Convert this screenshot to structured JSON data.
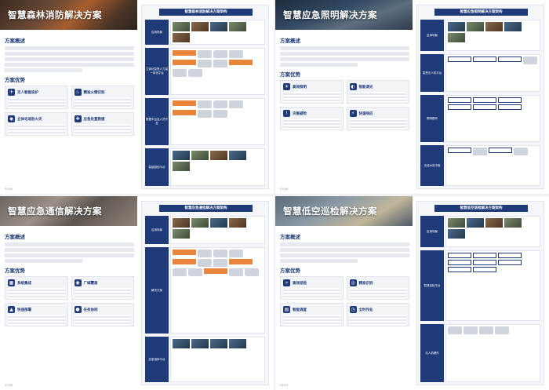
{
  "pages": [
    {
      "title": "智慧森林消防解决方案",
      "overview_title": "方案概述",
      "advantages_title": "方案优势",
      "features": [
        {
          "title": "无人智能巡护"
        },
        {
          "title": "精准火情识别"
        },
        {
          "title": "立体化巡防火灾"
        },
        {
          "title": "应急处置救援"
        }
      ],
      "arch_title": "智慧森林消防解决方案架构",
      "rows": [
        "应用场景",
        "立体化智慧人力量一体化平台",
        "数据中台及人员开发",
        "智能感知平台"
      ],
      "page_number": "03/04"
    },
    {
      "title": "智慧应急照明解决方案",
      "overview_title": "方案概述",
      "advantages_title": "方案优势",
      "features": [
        {
          "title": "高效照明"
        },
        {
          "title": "智能调光"
        },
        {
          "title": "灾害避险"
        },
        {
          "title": "快速响应"
        }
      ],
      "arch_title": "智慧应急照明解决方案架构",
      "rows": [
        "应用场景",
        "智慧无人机平台",
        "照明模块",
        "无线对讲中枢"
      ],
      "page_number": "05/06"
    },
    {
      "title": "智慧应急通信解决方案",
      "overview_title": "方案概述",
      "advantages_title": "方案优势",
      "features": [
        {
          "title": "系统集成"
        },
        {
          "title": "广域覆盖"
        },
        {
          "title": "快速部署"
        },
        {
          "title": "任务协同"
        }
      ],
      "arch_title": "智慧应急通信解决方案架构",
      "rows": [
        "应用场景",
        "解决方案",
        "应急指挥平台"
      ],
      "page_number": "07/08"
    },
    {
      "title": "智慧低空巡检解决方案",
      "overview_title": "方案概述",
      "advantages_title": "方案优势",
      "features": [
        {
          "title": "高效巡检"
        },
        {
          "title": "精准识别"
        },
        {
          "title": "智能调度"
        },
        {
          "title": "全时作业"
        }
      ],
      "arch_title": "智慧低空巡检解决方案架构",
      "rows": [
        "应用场景",
        "智慧巡检平台",
        "无人机硬件"
      ],
      "page_number": "09/10"
    }
  ]
}
